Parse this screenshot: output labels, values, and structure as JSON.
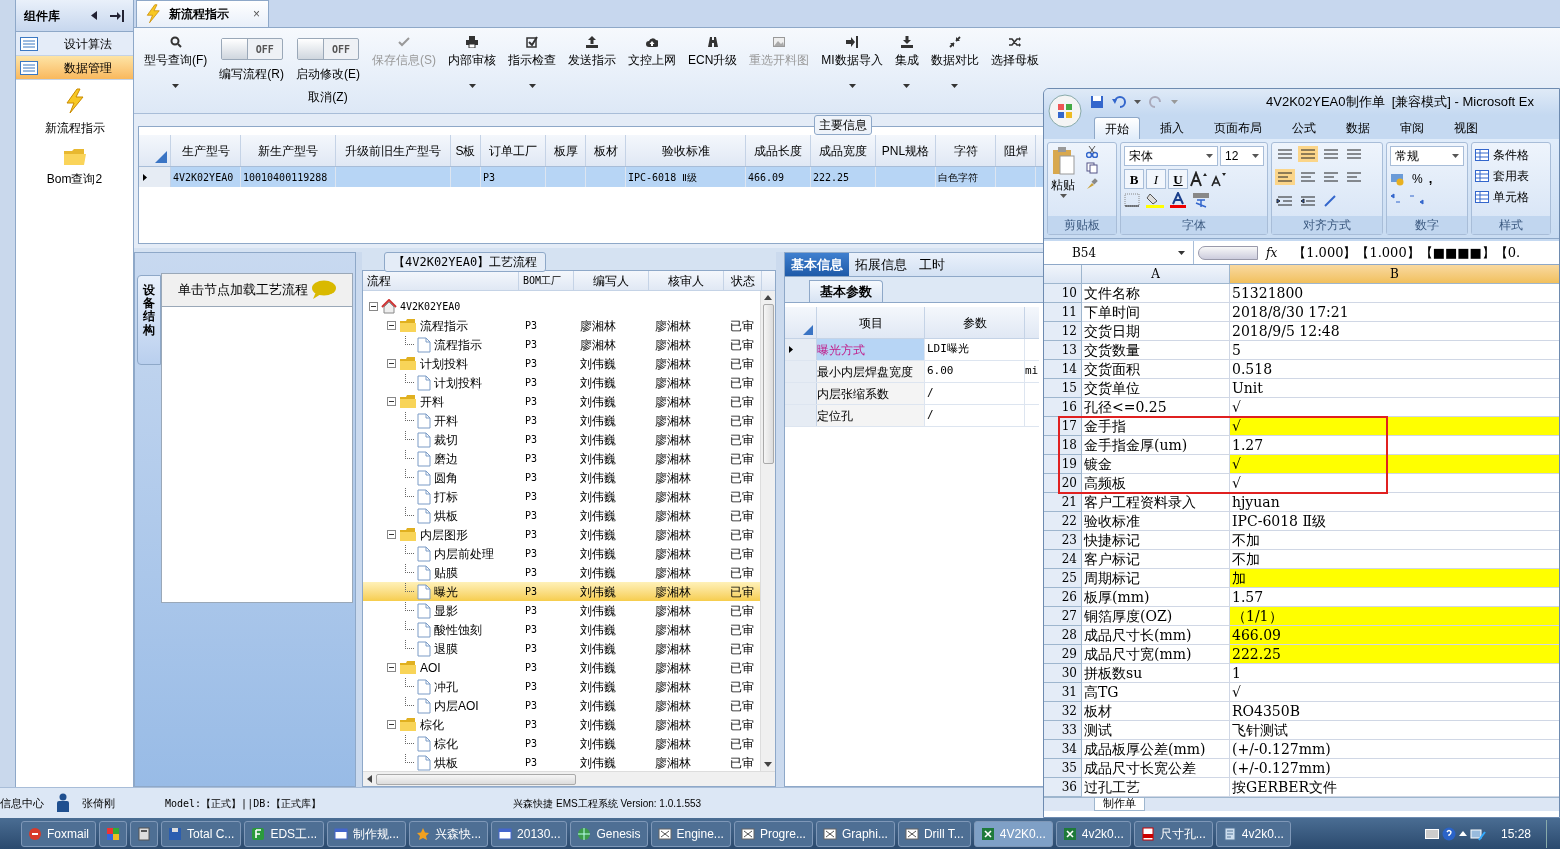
{
  "sidebar": {
    "title": "组件库",
    "items": [
      {
        "label": "设计算法",
        "selected": false
      },
      {
        "label": "数据管理",
        "selected": true
      }
    ],
    "tiles": [
      {
        "label": "新流程指示",
        "kind": "flash"
      },
      {
        "label": "Bom查询2",
        "kind": "folder"
      }
    ]
  },
  "doc_tab": {
    "label": "新流程指示",
    "close": "×"
  },
  "toolbar": [
    {
      "kind": "button",
      "label": "型号查询(F)",
      "dropdown": true,
      "disabled": false
    },
    {
      "kind": "toggle",
      "on": false,
      "state_text": "OFF",
      "label": "编写流程(R)"
    },
    {
      "kind": "toggle",
      "on": false,
      "state_text": "OFF",
      "label": "启动修改(E)",
      "sublabel": "取消(Z)"
    },
    {
      "kind": "button",
      "label": "保存信息(S)",
      "dropdown": false,
      "disabled": true
    },
    {
      "kind": "button",
      "label": "内部审核",
      "dropdown": true,
      "disabled": false
    },
    {
      "kind": "button",
      "label": "指示检查",
      "dropdown": true,
      "disabled": false
    },
    {
      "kind": "button",
      "label": "发送指示",
      "dropdown": false,
      "disabled": false
    },
    {
      "kind": "button",
      "label": "文控上网",
      "dropdown": false,
      "disabled": false
    },
    {
      "kind": "button",
      "label": "ECN升级",
      "dropdown": false,
      "disabled": false
    },
    {
      "kind": "button",
      "label": "重选开料图",
      "dropdown": false,
      "disabled": true
    },
    {
      "kind": "button",
      "label": "MI数据导入",
      "dropdown": true,
      "disabled": false
    },
    {
      "kind": "button",
      "label": "集成",
      "dropdown": true,
      "disabled": false
    },
    {
      "kind": "button",
      "label": "数据对比",
      "dropdown": true,
      "disabled": false
    },
    {
      "kind": "button",
      "label": "选择母板",
      "dropdown": false,
      "disabled": false
    }
  ],
  "main_info": {
    "title": "主要信息",
    "row_selected": true,
    "columns": [
      {
        "header": "生产型号",
        "value": "4V2K02YEA0"
      },
      {
        "header": "新生产型号",
        "value": "10010400119288"
      },
      {
        "header": "升级前旧生产型号"
      },
      {
        "header": "S板"
      },
      {
        "header": "订单工厂",
        "value": "P3"
      },
      {
        "header": "板厚"
      },
      {
        "header": "板材"
      },
      {
        "header": "验收标准",
        "value": "IPC-6018 Ⅱ级"
      },
      {
        "header": "成品长度",
        "value": "466.09"
      },
      {
        "header": "成品宽度",
        "value": "222.25"
      },
      {
        "header": "PNL规格"
      },
      {
        "header": "字符",
        "value": "白色字符"
      },
      {
        "header": "阻焊"
      }
    ]
  },
  "structure_panel": {
    "side_tab": "设备结构",
    "hint": "单击节点加载工艺流程"
  },
  "process_tree": {
    "title": "【4V2K02YEA0】工艺流程",
    "columns": [
      "流程",
      "BOM工厂",
      "编写人",
      "核审人",
      "状态"
    ],
    "nodes": [
      {
        "label": "4V2K02YEA0",
        "kind": "root",
        "expanded": true,
        "children": [
          {
            "label": "流程指示",
            "kind": "folder",
            "expanded": true,
            "cells": [
              "P3",
              "廖湘林",
              "廖湘林",
              "已审"
            ],
            "children": [
              {
                "label": "流程指示",
                "kind": "doc",
                "selected": false,
                "cells": [
                  "P3",
                  "廖湘林",
                  "廖湘林",
                  "已审"
                ]
              }
            ]
          },
          {
            "label": "计划投料",
            "kind": "folder",
            "expanded": true,
            "cells": [
              "P3",
              "刘伟巍",
              "廖湘林",
              "已审"
            ],
            "children": [
              {
                "label": "计划投料",
                "kind": "doc",
                "selected": false,
                "cells": [
                  "P3",
                  "刘伟巍",
                  "廖湘林",
                  "已审"
                ]
              }
            ]
          },
          {
            "label": "开料",
            "kind": "folder",
            "expanded": true,
            "cells": [
              "P3",
              "刘伟巍",
              "廖湘林",
              "已审"
            ],
            "children": [
              {
                "label": "开料",
                "kind": "doc",
                "selected": false,
                "cells": [
                  "P3",
                  "刘伟巍",
                  "廖湘林",
                  "已审"
                ]
              },
              {
                "label": "裁切",
                "kind": "doc",
                "selected": false,
                "cells": [
                  "P3",
                  "刘伟巍",
                  "廖湘林",
                  "已审"
                ]
              },
              {
                "label": "磨边",
                "kind": "doc",
                "selected": false,
                "cells": [
                  "P3",
                  "刘伟巍",
                  "廖湘林",
                  "已审"
                ]
              },
              {
                "label": "圆角",
                "kind": "doc",
                "selected": false,
                "cells": [
                  "P3",
                  "刘伟巍",
                  "廖湘林",
                  "已审"
                ]
              },
              {
                "label": "打标",
                "kind": "doc",
                "selected": false,
                "cells": [
                  "P3",
                  "刘伟巍",
                  "廖湘林",
                  "已审"
                ]
              },
              {
                "label": "烘板",
                "kind": "doc",
                "selected": false,
                "cells": [
                  "P3",
                  "刘伟巍",
                  "廖湘林",
                  "已审"
                ]
              }
            ]
          },
          {
            "label": "内层图形",
            "kind": "folder",
            "expanded": true,
            "cells": [
              "P3",
              "刘伟巍",
              "廖湘林",
              "已审"
            ],
            "children": [
              {
                "label": "内层前处理",
                "kind": "doc",
                "selected": false,
                "cells": [
                  "P3",
                  "刘伟巍",
                  "廖湘林",
                  "已审"
                ]
              },
              {
                "label": "贴膜",
                "kind": "doc",
                "selected": false,
                "cells": [
                  "P3",
                  "刘伟巍",
                  "廖湘林",
                  "已审"
                ]
              },
              {
                "label": "曝光",
                "kind": "doc",
                "selected": true,
                "cells": [
                  "P3",
                  "刘伟巍",
                  "廖湘林",
                  "已审"
                ]
              },
              {
                "label": "显影",
                "kind": "doc",
                "selected": false,
                "cells": [
                  "P3",
                  "刘伟巍",
                  "廖湘林",
                  "已审"
                ]
              },
              {
                "label": "酸性蚀刻",
                "kind": "doc",
                "selected": false,
                "cells": [
                  "P3",
                  "刘伟巍",
                  "廖湘林",
                  "已审"
                ]
              },
              {
                "label": "退膜",
                "kind": "doc",
                "selected": false,
                "cells": [
                  "P3",
                  "刘伟巍",
                  "廖湘林",
                  "已审"
                ]
              }
            ]
          },
          {
            "label": "AOI",
            "kind": "folder",
            "expanded": true,
            "cells": [
              "P3",
              "刘伟巍",
              "廖湘林",
              "已审"
            ],
            "children": [
              {
                "label": "冲孔",
                "kind": "doc",
                "selected": false,
                "cells": [
                  "P3",
                  "刘伟巍",
                  "廖湘林",
                  "已审"
                ]
              },
              {
                "label": "内层AOI",
                "kind": "doc",
                "selected": false,
                "cells": [
                  "P3",
                  "刘伟巍",
                  "廖湘林",
                  "已审"
                ]
              }
            ]
          },
          {
            "label": "棕化",
            "kind": "folder",
            "expanded": true,
            "cells": [
              "P3",
              "刘伟巍",
              "廖湘林",
              "已审"
            ],
            "children": [
              {
                "label": "棕化",
                "kind": "doc",
                "selected": false,
                "cells": [
                  "P3",
                  "刘伟巍",
                  "廖湘林",
                  "已审"
                ]
              },
              {
                "label": "烘板",
                "kind": "doc",
                "selected": false,
                "cells": [
                  "P3",
                  "刘伟巍",
                  "廖湘林",
                  "已审"
                ]
              }
            ]
          }
        ]
      }
    ]
  },
  "info_panel": {
    "tabs": [
      {
        "label": "基本信息",
        "selected": true
      },
      {
        "label": "拓展信息",
        "selected": false
      },
      {
        "label": "工时",
        "selected": false
      }
    ],
    "subtab": "基本参数",
    "columns": [
      "项目",
      "参数"
    ],
    "rows": [
      {
        "item": "曝光方式",
        "value": "LDI曝光",
        "selected": true
      },
      {
        "item": "最小内层焊盘宽度",
        "value": "6.00",
        "extra": "mi",
        "selected": false
      },
      {
        "item": "内层张缩系数",
        "value": "/",
        "selected": false
      },
      {
        "item": "定位孔",
        "value": "/",
        "selected": false
      }
    ]
  },
  "status_bar": {
    "left": "信息中心",
    "user": "张倚刚",
    "model": "Model:【正式】||DB:【正式库】",
    "app": "兴森快捷 EMS工程系统 Version: 1.0.1.553"
  },
  "excel": {
    "title": "4V2K02YEA0制作单  [兼容模式] - Microsoft Ex",
    "tabs": [
      {
        "label": "开始",
        "selected": true
      },
      {
        "label": "插入",
        "selected": false
      },
      {
        "label": "页面布局",
        "selected": false
      },
      {
        "label": "公式",
        "selected": false
      },
      {
        "label": "数据",
        "selected": false
      },
      {
        "label": "审阅",
        "selected": false
      },
      {
        "label": "视图",
        "selected": false
      }
    ],
    "ribbon": {
      "paste": "粘贴",
      "font": "宋体",
      "size": "12",
      "format_buttons": [
        "B",
        "I",
        "U"
      ],
      "number_format": "常规",
      "percent": "%",
      "comma": ",",
      "styles": [
        "条件格",
        "套用表",
        "单元格"
      ],
      "groups": [
        "剪贴板",
        "字体",
        "对齐方式",
        "数字",
        "样式"
      ]
    },
    "name_box": "B54",
    "fx": "fx",
    "formula": "【1.000】【1.000】【■■■■】【0.",
    "col_headers": [
      "A",
      "B"
    ],
    "rows": [
      {
        "number": "10",
        "a": "文件名称",
        "b": "51321800",
        "fill": false
      },
      {
        "number": "11",
        "a": "下单时间",
        "b": "2018/8/30 17:21",
        "fill": false
      },
      {
        "number": "12",
        "a": "交货日期",
        "b": "2018/9/5 12:48",
        "fill": false
      },
      {
        "number": "13",
        "a": "交货数量",
        "b": "5",
        "fill": false
      },
      {
        "number": "14",
        "a": "交货面积",
        "b": "0.518",
        "fill": false
      },
      {
        "number": "15",
        "a": "交货单位",
        "b": "Unit",
        "fill": false
      },
      {
        "number": "16",
        "a": "孔径<=0.25",
        "b": "√",
        "fill": false
      },
      {
        "number": "17",
        "a": "金手指",
        "b": "√",
        "fill": true
      },
      {
        "number": "18",
        "a": "金手指金厚(um)",
        "b": "1.27",
        "fill": false
      },
      {
        "number": "19",
        "a": "镀金",
        "b": "√",
        "fill": true
      },
      {
        "number": "20",
        "a": "高频板",
        "b": "√",
        "fill": false
      },
      {
        "number": "21",
        "a": "客户工程资料录入",
        "b": "hjyuan",
        "fill": false
      },
      {
        "number": "22",
        "a": "验收标准",
        "b": "IPC-6018 Ⅱ级",
        "fill": false
      },
      {
        "number": "23",
        "a": "快捷标记",
        "b": "不加",
        "fill": false
      },
      {
        "number": "24",
        "a": "客户标记",
        "b": "不加",
        "fill": false
      },
      {
        "number": "25",
        "a": "周期标记",
        "b": "加",
        "fill": true
      },
      {
        "number": "26",
        "a": "板厚(mm)",
        "b": "1.57",
        "fill": false
      },
      {
        "number": "27",
        "a": "铜箔厚度(OZ)",
        "b": "（1/1）",
        "fill": true
      },
      {
        "number": "28",
        "a": "成品尺寸长(mm)",
        "b": "466.09",
        "fill": true
      },
      {
        "number": "29",
        "a": "成品尺寸宽(mm)",
        "b": "222.25",
        "fill": true
      },
      {
        "number": "30",
        "a": "拼板数su",
        "b": "1",
        "fill": false
      },
      {
        "number": "31",
        "a": "高TG",
        "b": "√",
        "fill": false
      },
      {
        "number": "32",
        "a": "板材",
        "b": "RO4350B",
        "fill": false
      },
      {
        "number": "33",
        "a": "测试",
        "b": "飞针测试",
        "fill": false
      },
      {
        "number": "34",
        "a": "成品板厚公差(mm)",
        "b": "(+/-0.127mm)",
        "fill": false
      },
      {
        "number": "35",
        "a": "成品尺寸长宽公差",
        "b": "(+/-0.127mm)",
        "fill": false
      },
      {
        "number": "36",
        "a": "过孔工艺",
        "b": "按GERBER文件",
        "fill": false
      }
    ],
    "sheet_tab": "制作单"
  },
  "taskbar": {
    "items": [
      {
        "label": "Foxmail",
        "selected": false
      },
      {
        "selected": false
      },
      {
        "selected": false
      },
      {
        "label": "Total C...",
        "selected": false
      },
      {
        "label": "EDS工...",
        "selected": false
      },
      {
        "label": "制作规...",
        "selected": false
      },
      {
        "label": "兴森快...",
        "selected": false
      },
      {
        "label": "20130...",
        "selected": false
      },
      {
        "label": "Genesis",
        "selected": false
      },
      {
        "label": "Engine...",
        "selected": false
      },
      {
        "label": "Progre...",
        "selected": false
      },
      {
        "label": "Graphi...",
        "selected": false
      },
      {
        "label": "Drill T...",
        "selected": false
      },
      {
        "label": "4V2K0...",
        "selected": true
      },
      {
        "label": "4v2k0...",
        "selected": false
      },
      {
        "label": "尺寸孔...",
        "selected": false
      },
      {
        "label": "4v2k0...",
        "selected": false
      }
    ],
    "clock": "15:28"
  }
}
